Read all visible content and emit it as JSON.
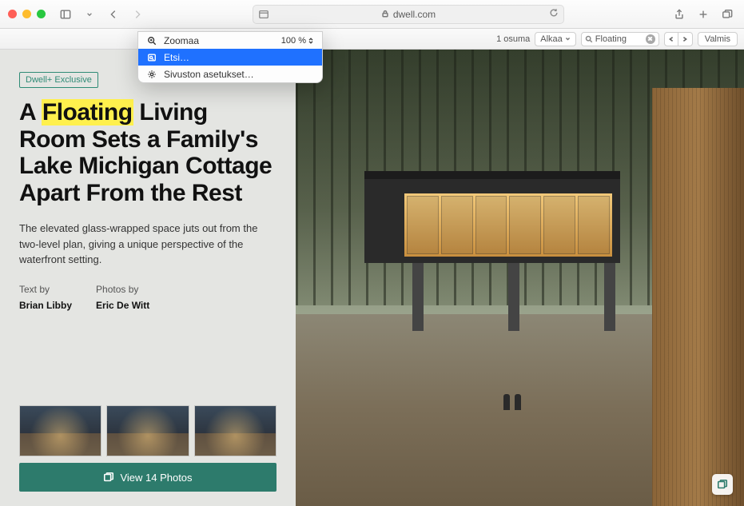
{
  "address": {
    "domain": "dwell.com"
  },
  "menu": {
    "zoom_label": "Zoomaa",
    "zoom_value": "100 %",
    "find_label": "Etsi…",
    "settings_label": "Sivuston asetukset…"
  },
  "findbar": {
    "count_text": "1 osuma",
    "scope_label": "Alkaa",
    "search_value": "Floating",
    "done_label": "Valmis"
  },
  "article": {
    "badge": "Dwell+ Exclusive",
    "headline_pre": "A ",
    "headline_hl": "Floating",
    "headline_post": " Living Room Sets a Family's Lake Michigan Cottage Apart From the Rest",
    "sub": "The elevated glass-wrapped space juts out from the two-level plan, giving a unique perspective of the waterfront setting.",
    "text_by_label": "Text by",
    "text_by": "Brian Libby",
    "photos_by_label": "Photos by",
    "photos_by": "Eric De Witt",
    "view_photos_label": "View 14 Photos"
  }
}
